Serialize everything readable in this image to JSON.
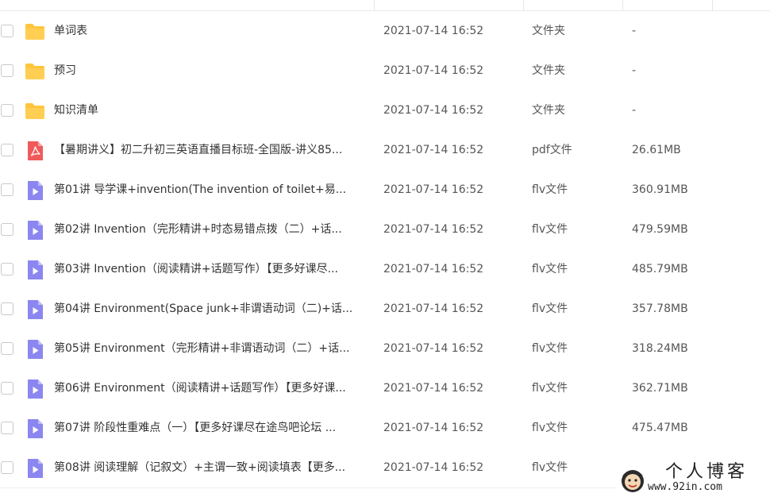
{
  "colors": {
    "folder": "#FFC53D",
    "pdf": "#F05A5A",
    "video": "#8B86F0"
  },
  "files": [
    {
      "icon": "folder-icon",
      "name": "单词表",
      "date": "2021-07-14 16:52",
      "type": "文件夹",
      "size": "-"
    },
    {
      "icon": "folder-icon",
      "name": "预习",
      "date": "2021-07-14 16:52",
      "type": "文件夹",
      "size": "-"
    },
    {
      "icon": "folder-icon",
      "name": "知识清单",
      "date": "2021-07-14 16:52",
      "type": "文件夹",
      "size": "-"
    },
    {
      "icon": "pdf-icon",
      "name": "【暑期讲义】初二升初三英语直播目标班-全国版-讲义85...",
      "date": "2021-07-14 16:52",
      "type": "pdf文件",
      "size": "26.61MB"
    },
    {
      "icon": "video-icon",
      "name": "第01讲 导学课+invention(The invention of toilet+易...",
      "date": "2021-07-14 16:52",
      "type": "flv文件",
      "size": "360.91MB"
    },
    {
      "icon": "video-icon",
      "name": "第02讲 Invention（完形精讲+时态易错点拨（二）+话...",
      "date": "2021-07-14 16:52",
      "type": "flv文件",
      "size": "479.59MB"
    },
    {
      "icon": "video-icon",
      "name": "第03讲 Invention（阅读精讲+话题写作）【更多好课尽...",
      "date": "2021-07-14 16:52",
      "type": "flv文件",
      "size": "485.79MB"
    },
    {
      "icon": "video-icon",
      "name": "第04讲 Environment(Space junk+非谓语动词（二)+话...",
      "date": "2021-07-14 16:52",
      "type": "flv文件",
      "size": "357.78MB"
    },
    {
      "icon": "video-icon",
      "name": "第05讲 Environment（完形精讲+非谓语动词（二）+话...",
      "date": "2021-07-14 16:52",
      "type": "flv文件",
      "size": "318.24MB"
    },
    {
      "icon": "video-icon",
      "name": "第06讲 Environment（阅读精讲+话题写作）【更多好课...",
      "date": "2021-07-14 16:52",
      "type": "flv文件",
      "size": "362.71MB"
    },
    {
      "icon": "video-icon",
      "name": "第07讲 阶段性重难点（一）【更多好课尽在途鸟吧论坛 ...",
      "date": "2021-07-14 16:52",
      "type": "flv文件",
      "size": "475.47MB"
    },
    {
      "icon": "video-icon",
      "name": "第08讲 阅读理解（记叙文）+主谓一致+阅读填表【更多...",
      "date": "2021-07-14 16:52",
      "type": "flv文件",
      "size": ""
    }
  ],
  "watermark": {
    "title": "个人博客",
    "url": "www.92in.com"
  }
}
